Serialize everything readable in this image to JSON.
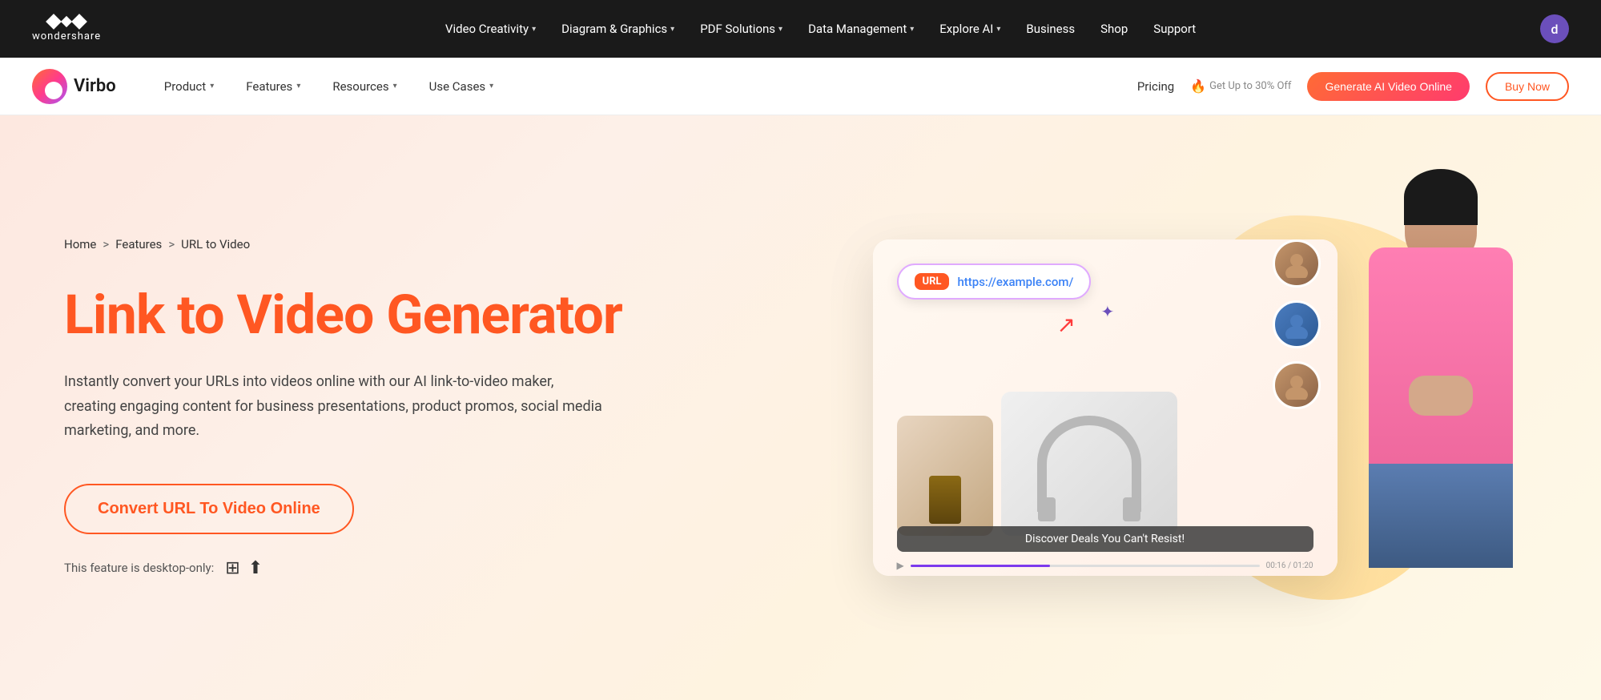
{
  "topNav": {
    "brand": "wondershare",
    "links": [
      {
        "label": "Video Creativity",
        "hasChevron": true
      },
      {
        "label": "Diagram & Graphics",
        "hasChevron": true
      },
      {
        "label": "PDF Solutions",
        "hasChevron": true
      },
      {
        "label": "Data Management",
        "hasChevron": true
      },
      {
        "label": "Explore AI",
        "hasChevron": true
      },
      {
        "label": "Business",
        "hasChevron": false
      },
      {
        "label": "Shop",
        "hasChevron": false
      },
      {
        "label": "Support",
        "hasChevron": false
      }
    ],
    "userInitial": "d"
  },
  "secNav": {
    "brandName": "Virbo",
    "links": [
      {
        "label": "Product",
        "hasChevron": true
      },
      {
        "label": "Features",
        "hasChevron": true
      },
      {
        "label": "Resources",
        "hasChevron": true
      },
      {
        "label": "Use Cases",
        "hasChevron": true
      }
    ],
    "pricing": "Pricing",
    "promo": "Get Up to 30% Off",
    "generateBtn": "Generate AI Video Online",
    "buyNowBtn": "Buy Now"
  },
  "hero": {
    "breadcrumb": {
      "home": "Home",
      "sep1": ">",
      "features": "Features",
      "sep2": ">",
      "current": "URL to Video"
    },
    "title": "Link to Video Generator",
    "description": "Instantly convert your URLs into videos online with our AI link-to-video maker, creating engaging content for business presentations, product promos, social media marketing, and more.",
    "convertBtn": "Convert URL To Video Online",
    "desktopLabel": "This feature is desktop-only:",
    "illustration": {
      "urlLabel": "URL",
      "urlValue": "https://example.com/",
      "dealsBanner": "Discover Deals You Can't Resist!",
      "timeProgress": "00:16 / 01:20"
    }
  }
}
